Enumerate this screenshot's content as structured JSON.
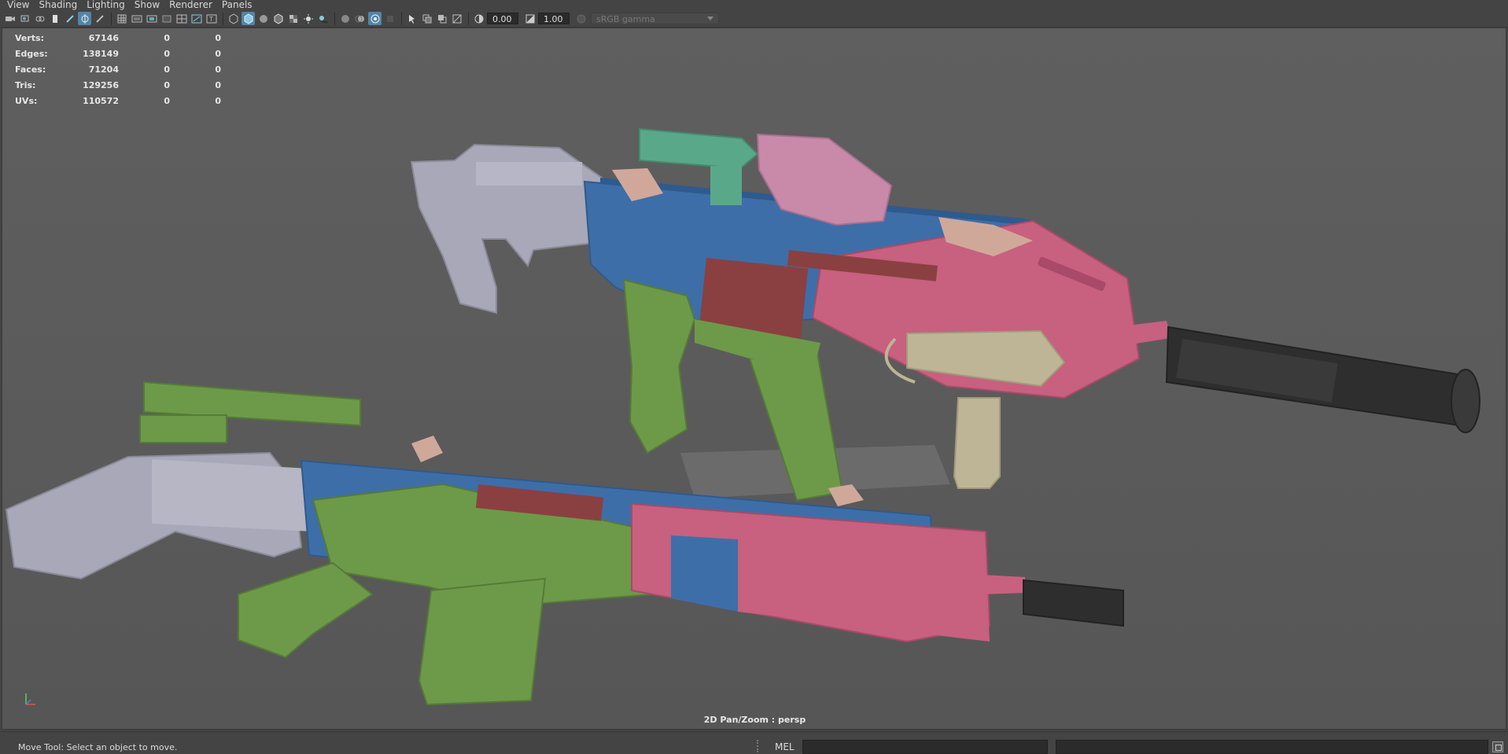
{
  "menu": {
    "items": [
      "View",
      "Shading",
      "Lighting",
      "Show",
      "Renderer",
      "Panels"
    ]
  },
  "toolbar": {
    "exposure": "0.00",
    "gamma": "1.00",
    "color_space": "sRGB gamma"
  },
  "hud": {
    "rows": [
      {
        "label": "Verts:",
        "v1": "67146",
        "v2": "0",
        "v3": "0"
      },
      {
        "label": "Edges:",
        "v1": "138149",
        "v2": "0",
        "v3": "0"
      },
      {
        "label": "Faces:",
        "v1": "71204",
        "v2": "0",
        "v3": "0"
      },
      {
        "label": "Tris:",
        "v1": "129256",
        "v2": "0",
        "v3": "0"
      },
      {
        "label": "UVs:",
        "v1": "110572",
        "v2": "0",
        "v3": "0"
      }
    ]
  },
  "viewport": {
    "panel_label": "2D Pan/Zoom : persp"
  },
  "status": {
    "help_line": "Move Tool: Select an object to move.",
    "command_language": "MEL"
  },
  "colors": {
    "accent": "#5285a6",
    "blue_part": "#3e6ea8",
    "pink_part": "#c8607f",
    "green_part": "#6d9a48",
    "grey_part": "#a8a8b8",
    "red_part": "#8a4040",
    "tan_part": "#bdb596",
    "teal_part": "#5aa88a",
    "dark_part": "#2e2e2e"
  }
}
